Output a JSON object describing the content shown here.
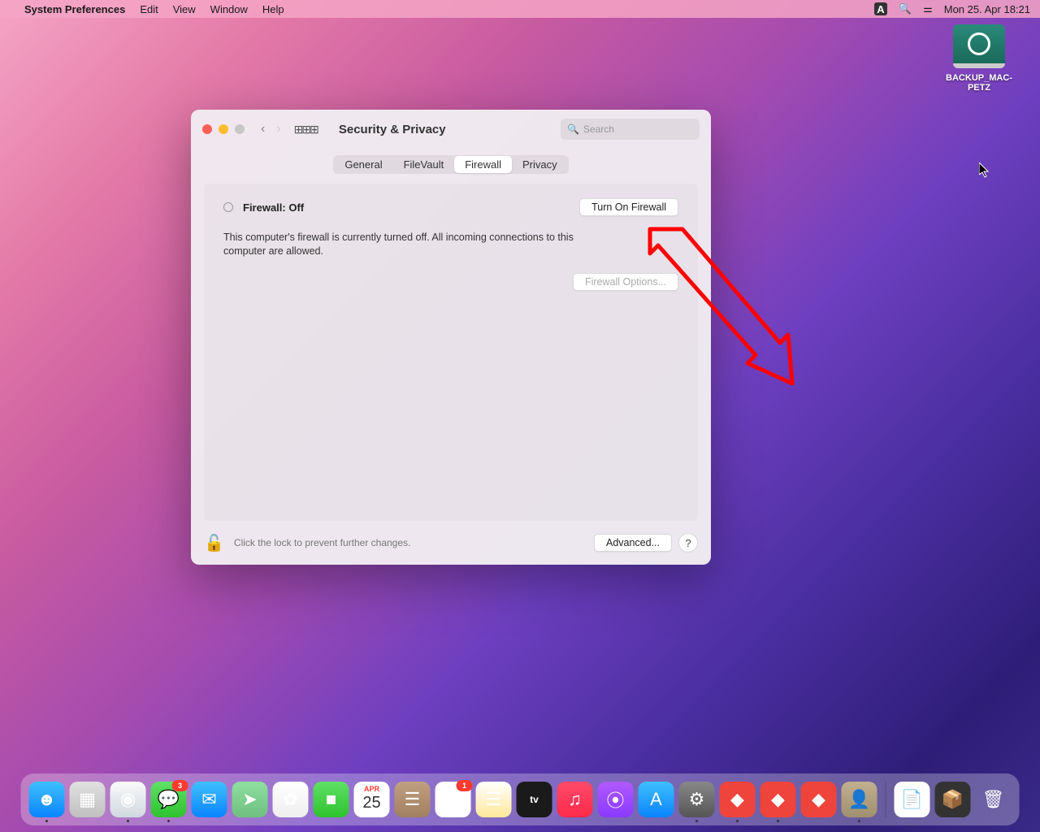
{
  "menubar": {
    "app": "System Preferences",
    "items": [
      "Edit",
      "View",
      "Window",
      "Help"
    ],
    "status": {
      "a": "A",
      "clock": "Mon 25. Apr  18:21"
    }
  },
  "desktop": {
    "drive_label": "BACKUP_MAC-PETZ"
  },
  "window": {
    "title": "Security & Privacy",
    "search_placeholder": "Search",
    "tabs": [
      "General",
      "FileVault",
      "Firewall",
      "Privacy"
    ],
    "active_tab": "Firewall",
    "firewall": {
      "status": "Firewall: Off",
      "turn_on": "Turn On Firewall",
      "desc": "This computer's firewall is currently turned off. All incoming connections to this computer are allowed.",
      "options": "Firewall Options..."
    },
    "footer": {
      "lock_text": "Click the lock to prevent further changes.",
      "advanced": "Advanced...",
      "help": "?"
    }
  },
  "dock": {
    "apps": [
      {
        "name": "finder",
        "bg": "linear-gradient(#3fc0ff,#0a84ff)",
        "glyph": "☻",
        "running": true
      },
      {
        "name": "launchpad",
        "bg": "linear-gradient(#e0e0e0,#c0c0c0)",
        "glyph": "▦"
      },
      {
        "name": "safari",
        "bg": "linear-gradient(#fafafa,#d0d8e0)",
        "glyph": "◉",
        "running": true
      },
      {
        "name": "messages",
        "bg": "linear-gradient(#5fe066,#2ec22e)",
        "glyph": "💬",
        "badge": "3",
        "running": true
      },
      {
        "name": "mail",
        "bg": "linear-gradient(#3fc0ff,#0a84ff)",
        "glyph": "✉"
      },
      {
        "name": "maps",
        "bg": "linear-gradient(#8fe0a0,#6fc080)",
        "glyph": "➤"
      },
      {
        "name": "photos",
        "bg": "linear-gradient(#fff,#eee)",
        "glyph": "✿"
      },
      {
        "name": "facetime",
        "bg": "linear-gradient(#5fe066,#2ec22e)",
        "glyph": "■"
      },
      {
        "name": "calendar",
        "bg": "#fff",
        "glyph": "25"
      },
      {
        "name": "contacts",
        "bg": "linear-gradient(#c0a080,#a08060)",
        "glyph": "☰"
      },
      {
        "name": "reminders",
        "bg": "#fff",
        "glyph": "☰",
        "badge": "1"
      },
      {
        "name": "notes",
        "bg": "linear-gradient(#fff,#ffe89a)",
        "glyph": "☰"
      },
      {
        "name": "tv",
        "bg": "#1a1a1a",
        "glyph": "tv"
      },
      {
        "name": "music",
        "bg": "linear-gradient(#ff4a6a,#ff2a4a)",
        "glyph": "♫"
      },
      {
        "name": "podcasts",
        "bg": "linear-gradient(#b05aff,#8a3aff)",
        "glyph": "⦿"
      },
      {
        "name": "appstore",
        "bg": "linear-gradient(#3fc0ff,#0a84ff)",
        "glyph": "A"
      },
      {
        "name": "sysprefs",
        "bg": "linear-gradient(#888,#555)",
        "glyph": "⚙",
        "running": true
      },
      {
        "name": "anydesk1",
        "bg": "#ef443b",
        "glyph": "◆",
        "running": true
      },
      {
        "name": "anydesk2",
        "bg": "#ef443b",
        "glyph": "◆",
        "running": true
      },
      {
        "name": "anydesk3",
        "bg": "#ef443b",
        "glyph": "◆"
      },
      {
        "name": "avatar",
        "bg": "linear-gradient(#c0b090,#a09070)",
        "glyph": "👤",
        "running": true
      }
    ],
    "stack": [
      {
        "name": "doc",
        "bg": "#fff",
        "glyph": "📄"
      },
      {
        "name": "pkg",
        "bg": "#333",
        "glyph": "📦"
      },
      {
        "name": "trash",
        "bg": "transparent",
        "glyph": "🗑"
      }
    ]
  }
}
